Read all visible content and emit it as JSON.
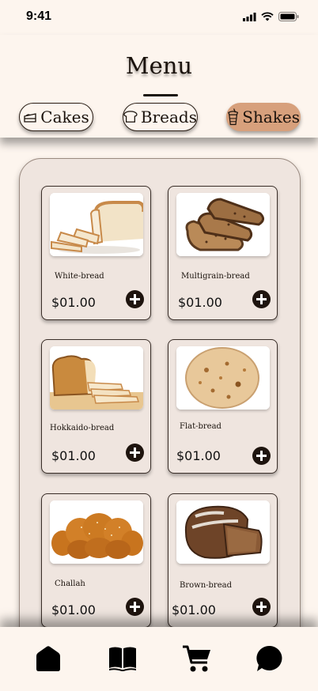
{
  "status": {
    "time": "9:41"
  },
  "header": {
    "title": "Menu"
  },
  "tabs": [
    {
      "label": "Cakes",
      "icon": "cake-icon",
      "active": false
    },
    {
      "label": "Breads",
      "icon": "bread-icon",
      "active": false
    },
    {
      "label": "Shakes",
      "icon": "shake-icon",
      "active": true
    }
  ],
  "products": [
    {
      "name": "White-bread",
      "price": "$01.00",
      "image": "white-bread-image"
    },
    {
      "name": "Multigrain-bread",
      "price": "$01.00",
      "image": "multigrain-bread-image"
    },
    {
      "name": "Hokkaido-bread",
      "price": "$01.00",
      "image": "hokkaido-bread-image"
    },
    {
      "name": "Flat-bread",
      "price": "$01.00",
      "image": "flat-bread-image"
    },
    {
      "name": "Challah",
      "price": "$01.00",
      "image": "challah-image"
    },
    {
      "name": "Brown-bread",
      "price": "$01.00",
      "image": "brown-bread-image"
    }
  ],
  "nav": [
    {
      "icon": "home-icon"
    },
    {
      "icon": "book-icon"
    },
    {
      "icon": "cart-icon"
    },
    {
      "icon": "chat-icon"
    }
  ],
  "colors": {
    "background": "#fdf5ee",
    "panel": "#efe5df",
    "accent": "#d7a07c",
    "dark": "#1e140e"
  }
}
